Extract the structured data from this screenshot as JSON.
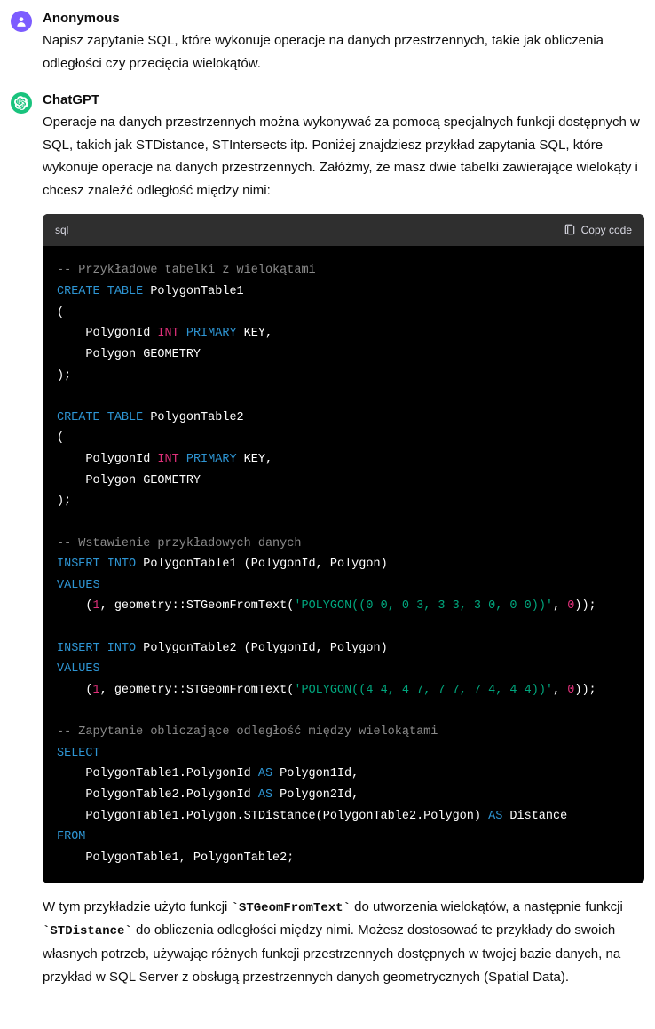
{
  "user": {
    "author": "Anonymous",
    "text": "Napisz zapytanie SQL, które wykonuje operacje na danych przestrzennych, takie jak obliczenia odległości czy przecięcia wielokątów."
  },
  "assistant": {
    "author": "ChatGPT",
    "intro": "Operacje na danych przestrzennych można wykonywać za pomocą specjalnych funkcji dostępnych w SQL, takich jak STDistance, STIntersects itp. Poniżej znajdziesz przykład zapytania SQL, które wykonuje operacje na danych przestrzennych. Załóżmy, że masz dwie tabelki zawierające wielokąty i chcesz znaleźć odległość między nimi:",
    "outro_part1": "W tym przykładzie użyto funkcji ",
    "outro_code1": "`STGeomFromText`",
    "outro_part2": " do utworzenia wielokątów, a następnie funkcji ",
    "outro_code2": "`STDistance`",
    "outro_part3": " do obliczenia odległości między nimi. Możesz dostosować te przykłady do swoich własnych potrzeb, używając różnych funkcji przestrzennych dostępnych w twojej bazie danych, na przykład w SQL Server z obsługą przestrzennych danych geometrycznych (Spatial Data)."
  },
  "code": {
    "lang": "sql",
    "copy_label": "Copy code",
    "c1": "-- Przykładowe tabelki z wielokątami",
    "kw_create": "CREATE",
    "kw_table": "TABLE",
    "t1": " PolygonTable1",
    "open": "(",
    "col1_a": "    PolygonId ",
    "ty_int": "INT",
    "sp": " ",
    "ty_primary": "PRIMARY",
    "col1_b": " KEY,",
    "col2": "    Polygon GEOMETRY",
    "close": ");",
    "t2": " PolygonTable2",
    "c2": "-- Wstawienie przykładowych danych",
    "kw_insert": "INSERT",
    "kw_into": "INTO",
    "ins1": " PolygonTable1 (PolygonId, Polygon)",
    "kw_values": "VALUES",
    "val_open": "    (",
    "num1": "1",
    "val_mid": ", geometry::STGeomFromText(",
    "str1": "'POLYGON((0 0, 0 3, 3 3, 3 0, 0 0))'",
    "val_comma": ", ",
    "num0": "0",
    "val_close": "));",
    "ins2": " PolygonTable2 (PolygonId, Polygon)",
    "str2": "'POLYGON((4 4, 4 7, 7 7, 7 4, 4 4))'",
    "c3": "-- Zapytanie obliczające odległość między wielokątami",
    "kw_select": "SELECT",
    "sel1a": "    PolygonTable1.PolygonId ",
    "kw_as": "AS",
    "sel1b": " Polygon1Id,",
    "sel2a": "    PolygonTable2.PolygonId ",
    "sel2b": " Polygon2Id,",
    "sel3a": "    PolygonTable1.Polygon.STDistance(PolygonTable2.Polygon) ",
    "sel3b": " Distance",
    "kw_from": "FROM",
    "from_line": "    PolygonTable1, PolygonTable2;"
  }
}
